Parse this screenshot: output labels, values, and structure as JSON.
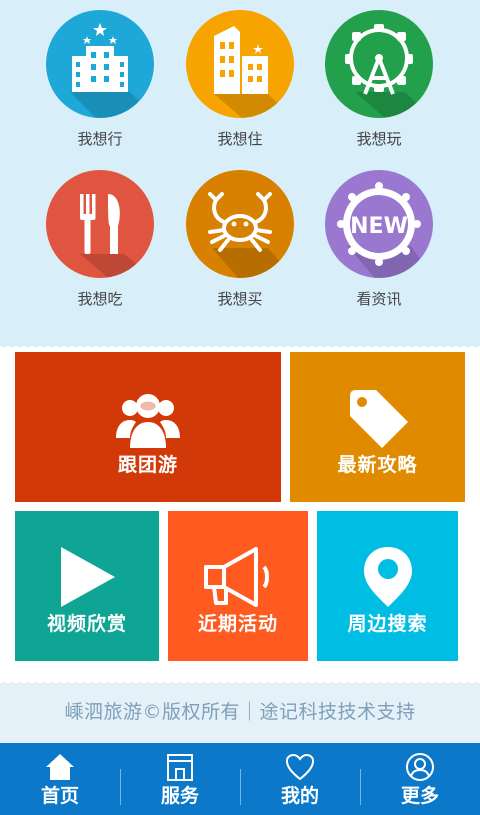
{
  "menu": {
    "row1": [
      {
        "label": "我想行",
        "color": "#1ea8d8",
        "icon": "hotel-building-icon"
      },
      {
        "label": "我想住",
        "color": "#f7a400",
        "icon": "apartment-icon"
      },
      {
        "label": "我想玩",
        "color": "#22a04b",
        "icon": "ferris-wheel-icon"
      }
    ],
    "row2": [
      {
        "label": "我想吃",
        "color": "#e0553f",
        "icon": "fork-knife-icon"
      },
      {
        "label": "我想买",
        "color": "#d88000",
        "icon": "crab-icon"
      },
      {
        "label": "看资讯",
        "color": "#9a78d0",
        "icon": "new-badge-icon"
      }
    ]
  },
  "tiles": {
    "group_tour": {
      "label": "跟团游",
      "color": "#d13a08",
      "icon": "group-people-icon"
    },
    "strategy": {
      "label": "最新攻略",
      "color": "#e08a00",
      "icon": "price-tag-icon"
    },
    "video": {
      "label": "视频欣赏",
      "color": "#0fa594",
      "icon": "play-icon"
    },
    "events": {
      "label": "近期活动",
      "color": "#ff5a1f",
      "icon": "megaphone-icon"
    },
    "nearby": {
      "label": "周边搜索",
      "color": "#00bde4",
      "icon": "map-pin-icon"
    }
  },
  "footer": {
    "text": "嵊泗旅游©版权所有｜途记科技技术支持"
  },
  "nav": [
    {
      "label": "首页",
      "icon": "home-icon"
    },
    {
      "label": "服务",
      "icon": "store-icon"
    },
    {
      "label": "我的",
      "icon": "heart-icon"
    },
    {
      "label": "更多",
      "icon": "user-circle-icon"
    }
  ]
}
